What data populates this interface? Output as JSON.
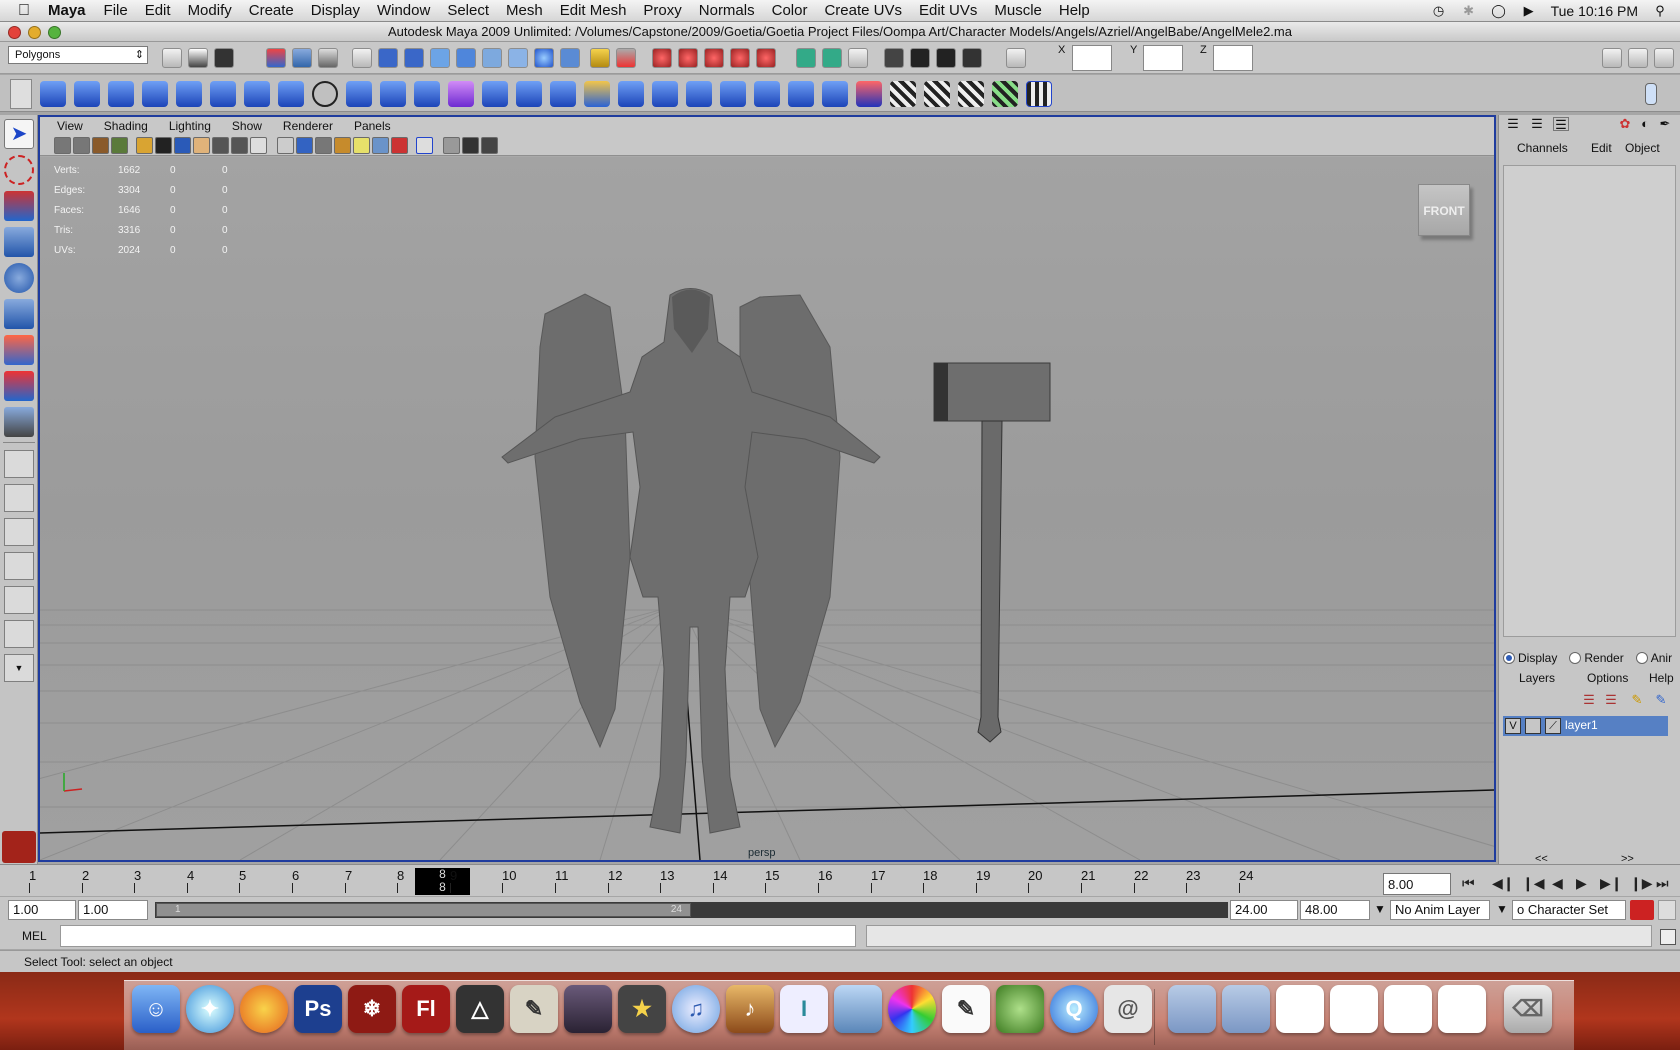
{
  "mac_menubar": {
    "app_name": "Maya",
    "items": [
      "File",
      "Edit",
      "Modify",
      "Create",
      "Display",
      "Window",
      "Select",
      "Mesh",
      "Edit Mesh",
      "Proxy",
      "Normals",
      "Color",
      "Create UVs",
      "Edit UVs",
      "Muscle",
      "Help"
    ],
    "clock": "Tue 10:16 PM"
  },
  "window": {
    "title": "Autodesk Maya 2009 Unlimited: /Volumes/Capstone/2009/Goetia/Goetia Project Files/Oompa Art/Character Models/Angels/Azriel/AngelBabe/AngelMele2.ma"
  },
  "status_line": {
    "menu_set": "Polygons",
    "x_label": "X",
    "y_label": "Y",
    "z_label": "Z"
  },
  "panel": {
    "menu": [
      "View",
      "Shading",
      "Lighting",
      "Show",
      "Renderer",
      "Panels"
    ],
    "hud": [
      {
        "label": "Verts:",
        "a": "1662",
        "b": "0",
        "c": "0"
      },
      {
        "label": "Edges:",
        "a": "3304",
        "b": "0",
        "c": "0"
      },
      {
        "label": "Faces:",
        "a": "1646",
        "b": "0",
        "c": "0"
      },
      {
        "label": "Tris:",
        "a": "3316",
        "b": "0",
        "c": "0"
      },
      {
        "label": "UVs:",
        "a": "2024",
        "b": "0",
        "c": "0"
      }
    ],
    "view_cube": "FRONT",
    "camera": "persp"
  },
  "channel_box": {
    "menu": [
      "Channels",
      "Edit",
      "Object"
    ]
  },
  "layer_editor": {
    "modes": [
      "Display",
      "Render",
      "Anir"
    ],
    "menu": [
      "Layers",
      "Options",
      "Help"
    ],
    "layer_name": "layer1",
    "visibility": "V",
    "nav_prev": "<<",
    "nav_next": ">>"
  },
  "time_slider": {
    "frames": [
      "1",
      "2",
      "3",
      "4",
      "5",
      "6",
      "7",
      "8",
      "9",
      "10",
      "11",
      "12",
      "13",
      "14",
      "15",
      "16",
      "17",
      "18",
      "19",
      "20",
      "21",
      "22",
      "23",
      "24"
    ],
    "current_frame": "8",
    "current_frame_field": "8.00"
  },
  "range_slider": {
    "anim_start": "1.00",
    "range_start": "1.00",
    "handle_start": "1",
    "handle_end": "24",
    "range_end": "24.00",
    "anim_end": "48.00",
    "anim_layer": "No Anim Layer",
    "character_set": "o Character Set"
  },
  "command_line": {
    "mel_label": "MEL"
  },
  "help_line": "Select Tool: select an object",
  "dock": [
    "Finder",
    "Safari",
    "Firefox",
    "Photoshop",
    "Maya",
    "Flash",
    "Unity",
    "Script Editor",
    "Warcraft",
    "iMovie",
    "iTunes",
    "GarageBand",
    "Script",
    "iPhoto",
    "Colors",
    "TextEdit",
    "Growl",
    "QuickTime",
    "Mail",
    "Documents",
    "Downloads",
    "Trash"
  ],
  "colors": {
    "panel_border": "#1f3c9e",
    "layer_highlight": "#5680c4",
    "viewport_bg": "#a3a3a3"
  }
}
